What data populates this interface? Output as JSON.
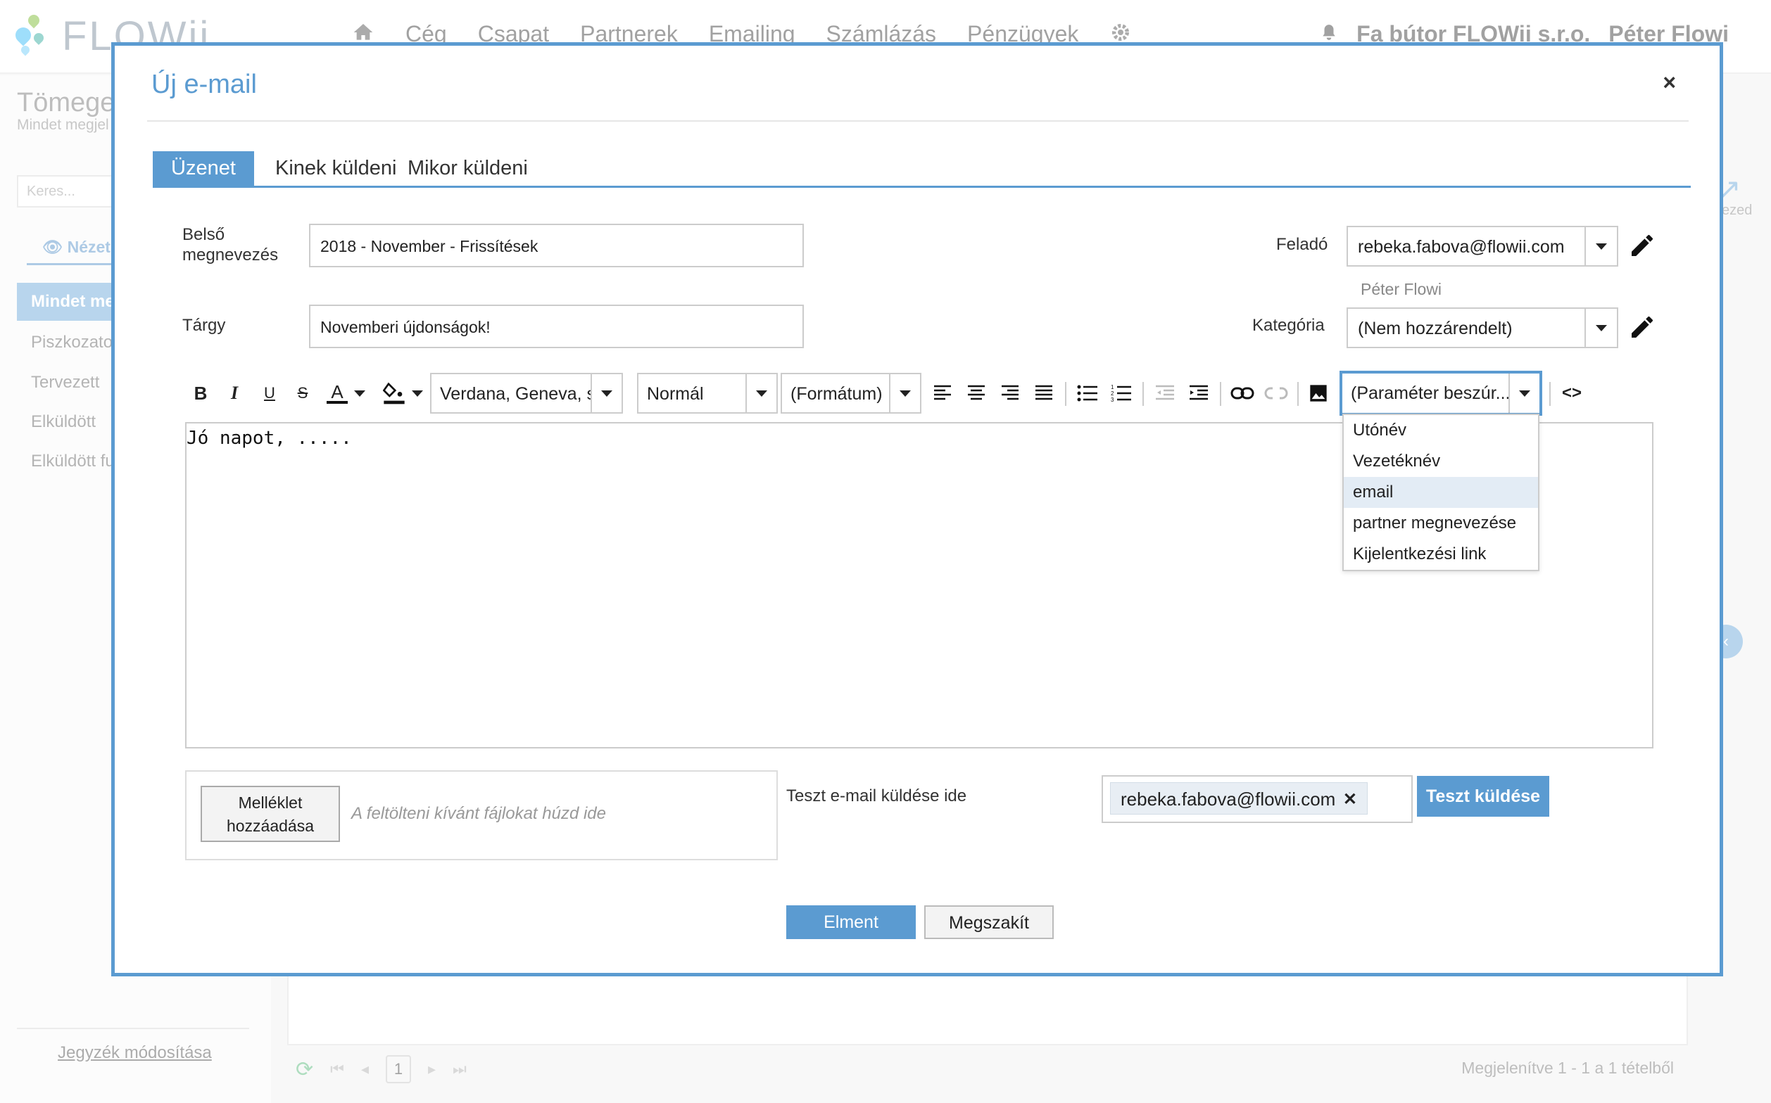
{
  "app": {
    "logo_text": "FLOWii",
    "nav": [
      "Cég",
      "Csapat",
      "Partnerek",
      "Emailing",
      "Számlázás",
      "Pénzügyek"
    ],
    "company": "Fa bútor FLOWii s.r.o.",
    "user": "Péter Flowi"
  },
  "background": {
    "page_title": "Tömege",
    "page_subtitle": "Mindet megjel",
    "search_placeholder": "Keres...",
    "view_label": "Nézet",
    "active_item": "Mindet me",
    "items": [
      "Piszkozato",
      "Tervezett",
      "Elküldött",
      "Elküldött fu"
    ],
    "edit_link": "Jegyzék módosítása",
    "page_number": "1",
    "footer_info": "Megjelenítve 1 - 1 a 1 tételből",
    "right_ghost_label": "ezed"
  },
  "modal": {
    "title": "Új e-mail",
    "close": "×",
    "tabs": [
      "Üzenet",
      "Kinek küldeni",
      "Mikor küldeni"
    ],
    "internal_name_label_1": "Belső",
    "internal_name_label_2": "megnevezés",
    "internal_name_value": "2018 - November - Frissítések",
    "subject_label": "Tárgy",
    "subject_value": "Novemberi újdonságok!",
    "sender_label": "Feladó",
    "sender_value": "rebeka.fabova@flowii.com",
    "sender_name": "Péter Flowi",
    "category_label": "Kategória",
    "category_value": "(Nem hozzárendelt)",
    "toolbar": {
      "font": "Verdana, Geneva, sans-serif",
      "size": "Normál",
      "format": "(Formátum)",
      "param": "(Paraméter beszúr..."
    },
    "param_options": [
      "Utónév",
      "Vezetéknév",
      "email",
      "partner megnevezése",
      "Kijelentkezési link"
    ],
    "body_text": "Jó napot, .....",
    "attach_button_1": "Melléklet",
    "attach_button_2": "hozzáadása",
    "attach_hint": "A feltölteni kívánt fájlokat húzd ide",
    "test_label": "Teszt e-mail küldése ide",
    "test_email": "rebeka.fabova@flowii.com",
    "test_button": "Teszt küldése",
    "save_button": "Elment",
    "cancel_button": "Megszakít"
  },
  "colors": {
    "accent": "#5b9bd1",
    "highlight": "#e3ecf5",
    "green": "#6cc28b"
  }
}
